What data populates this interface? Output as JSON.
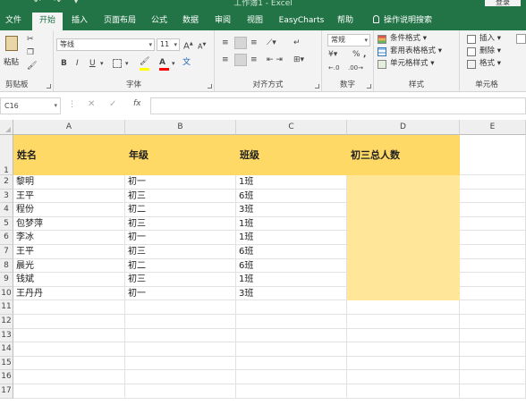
{
  "window": {
    "title": "工作簿1 - Excel",
    "login": "登录"
  },
  "ribbon_tabs": [
    "文件",
    "开始",
    "插入",
    "页面布局",
    "公式",
    "数据",
    "审阅",
    "视图",
    "EasyCharts",
    "帮助",
    "操作说明搜索"
  ],
  "active_tab": "开始",
  "clipboard": {
    "paste": "粘贴",
    "label": "剪贴板"
  },
  "font": {
    "name": "等线",
    "size": "11",
    "label": "字体",
    "bold": "B",
    "italic": "I",
    "underline": "U",
    "grow": "A",
    "shrink": "A",
    "color_btn": "A",
    "highlight_color": "#ffff00",
    "font_color": "#ff0000"
  },
  "alignment": {
    "label": "对齐方式"
  },
  "number": {
    "format": "常规",
    "label": "数字",
    "percent": "%",
    "comma": ","
  },
  "styles": {
    "conditional": "条件格式",
    "table": "套用表格格式",
    "cell": "单元格样式",
    "label": "样式"
  },
  "cells": {
    "insert": "插入",
    "delete": "删除",
    "format": "格式",
    "label": "单元格"
  },
  "formula_bar": {
    "namebox": "C16",
    "fx": "fx",
    "value": ""
  },
  "grid": {
    "columns": [
      "A",
      "B",
      "C",
      "D",
      "E"
    ],
    "rows": [
      "1",
      "2",
      "3",
      "4",
      "5",
      "6",
      "7",
      "8",
      "9",
      "10",
      "11",
      "12",
      "13",
      "14",
      "15",
      "16",
      "17"
    ],
    "header": [
      "姓名",
      "年级",
      "班级",
      "初三总人数"
    ],
    "data": [
      [
        "黎明",
        "初一",
        "1班"
      ],
      [
        "王平",
        "初三",
        "6班"
      ],
      [
        "程份",
        "初二",
        "3班"
      ],
      [
        "包梦萍",
        "初三",
        "1班"
      ],
      [
        "李冰",
        "初一",
        "1班"
      ],
      [
        "王平",
        "初三",
        "6班"
      ],
      [
        "晨光",
        "初二",
        "6班"
      ],
      [
        "钱斌",
        "初三",
        "1班"
      ],
      [
        "王丹丹",
        "初一",
        "3班"
      ]
    ],
    "header_fill": "#ffd966",
    "data_fill": "#ffe699"
  }
}
